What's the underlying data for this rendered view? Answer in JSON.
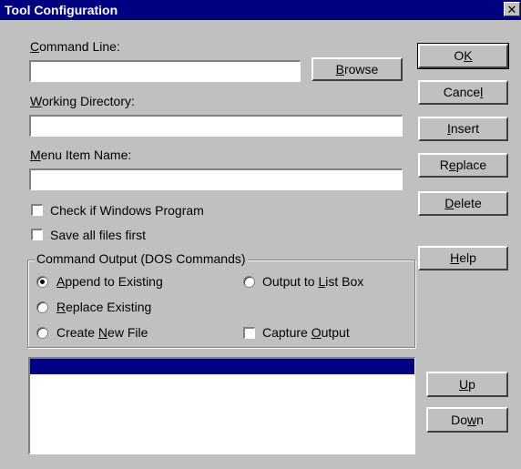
{
  "window": {
    "title": "Tool Configuration",
    "close_glyph": "✕"
  },
  "form": {
    "command_line": {
      "label_u": "C",
      "label_rest": "ommand Line:",
      "value": ""
    },
    "working_directory": {
      "label_u": "W",
      "label_rest": "orking Directory:",
      "value": ""
    },
    "menu_item_name": {
      "label_u": "M",
      "label_rest": "enu Item Name:",
      "value": ""
    },
    "browse": {
      "pre": "",
      "u": "B",
      "post": "rowse"
    },
    "check_windows": {
      "label": "Check if Windows Program",
      "checked": false
    },
    "save_all": {
      "label": "Save all files first",
      "checked": false
    }
  },
  "group": {
    "title": "Command Output (DOS Commands)",
    "append": {
      "pre": "",
      "u": "A",
      "post": "ppend to Existing",
      "selected": true
    },
    "replace": {
      "pre": "",
      "u": "R",
      "post": "eplace Existing",
      "selected": false
    },
    "create": {
      "pre": "Create ",
      "u": "N",
      "post": "ew File",
      "selected": false
    },
    "output_list": {
      "pre": "Output to ",
      "u": "L",
      "post": "ist Box",
      "selected": false
    },
    "capture": {
      "pre": "Capture ",
      "u": "O",
      "post": "utput",
      "checked": false
    }
  },
  "buttons": {
    "ok": {
      "pre": "O",
      "u": "K",
      "post": ""
    },
    "cancel": {
      "pre": "Cance",
      "u": "l",
      "post": ""
    },
    "insert": {
      "pre": "",
      "u": "I",
      "post": "nsert"
    },
    "replace": {
      "pre": "R",
      "u": "e",
      "post": "place"
    },
    "delete": {
      "pre": "",
      "u": "D",
      "post": "elete"
    },
    "help": {
      "pre": "",
      "u": "H",
      "post": "elp"
    },
    "up": {
      "pre": "",
      "u": "U",
      "post": "p"
    },
    "down": {
      "pre": "Do",
      "u": "w",
      "post": "n"
    }
  },
  "colors": {
    "titlebar": "#000080",
    "face": "#c0c0c0",
    "selection": "#000080"
  }
}
